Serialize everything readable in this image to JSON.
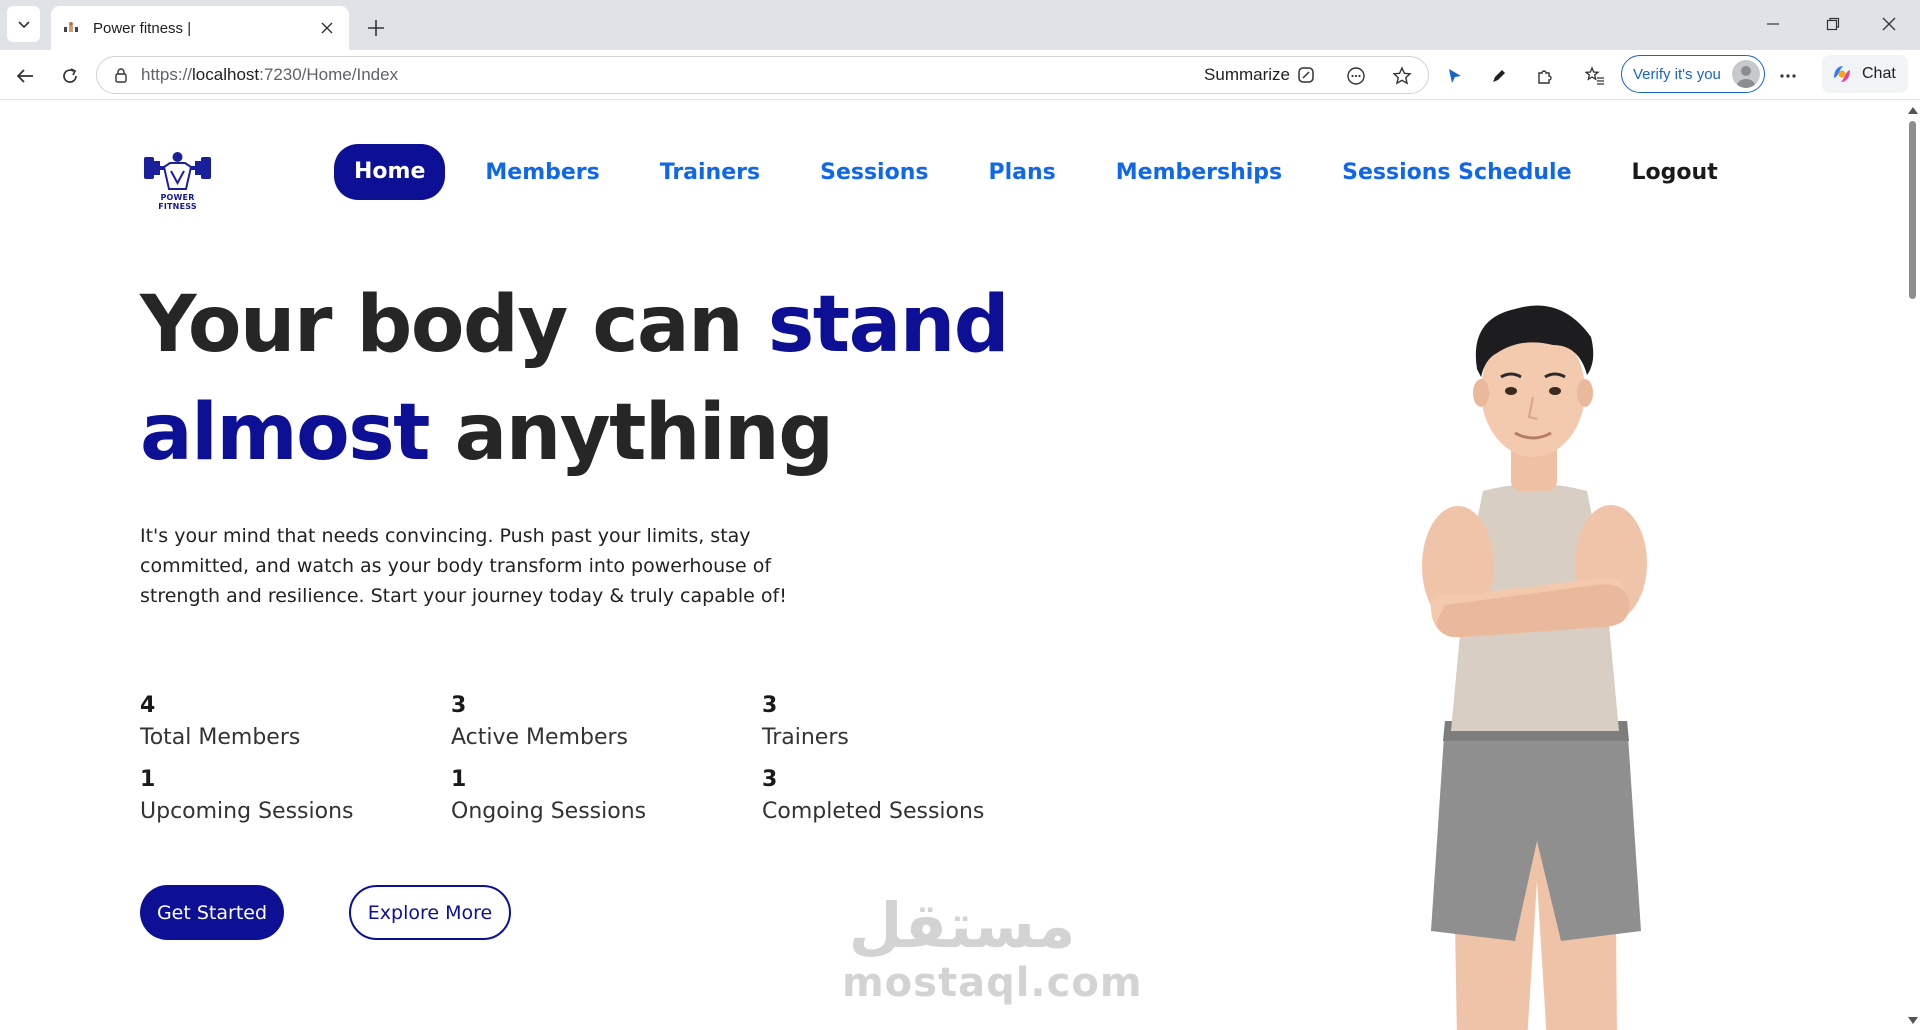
{
  "browser": {
    "tab_title": "Power fitness |",
    "url_prefix": "https://",
    "url_host": "localhost",
    "url_rest": ":7230/Home/Index",
    "summarize_label": "Summarize",
    "verify_label": "Verify it's you",
    "chat_label": "Chat"
  },
  "site": {
    "logo_text": "POWER FITNESS",
    "nav": {
      "home": "Home",
      "members": "Members",
      "trainers": "Trainers",
      "sessions": "Sessions",
      "plans": "Plans",
      "memberships": "Memberships",
      "sessions_schedule": "Sessions Schedule",
      "logout": "Logout"
    },
    "hero": {
      "title_part1": "Your body can ",
      "title_accent1": "stand",
      "title_accent2": "almost",
      "title_part2": " anything",
      "description": "It's your mind that needs convincing. Push past your limits, stay committed, and watch as your body transform into powerhouse of strength and resilience. Start your journey today & truly capable of!"
    },
    "stats": [
      {
        "value": "4",
        "label": "Total Members"
      },
      {
        "value": "3",
        "label": "Active Members"
      },
      {
        "value": "3",
        "label": "Trainers"
      },
      {
        "value": "1",
        "label": "Upcoming Sessions"
      },
      {
        "value": "1",
        "label": "Ongoing Sessions"
      },
      {
        "value": "3",
        "label": "Completed Sessions"
      }
    ],
    "buttons": {
      "get_started": "Get Started",
      "explore_more": "Explore More"
    },
    "watermark": {
      "arabic": "مستقل",
      "latin": "mostaql.com"
    }
  },
  "colors": {
    "brand_navy": "#0d0f94",
    "nav_link_blue": "#1168e6",
    "browser_link_blue": "#1a63c9"
  }
}
